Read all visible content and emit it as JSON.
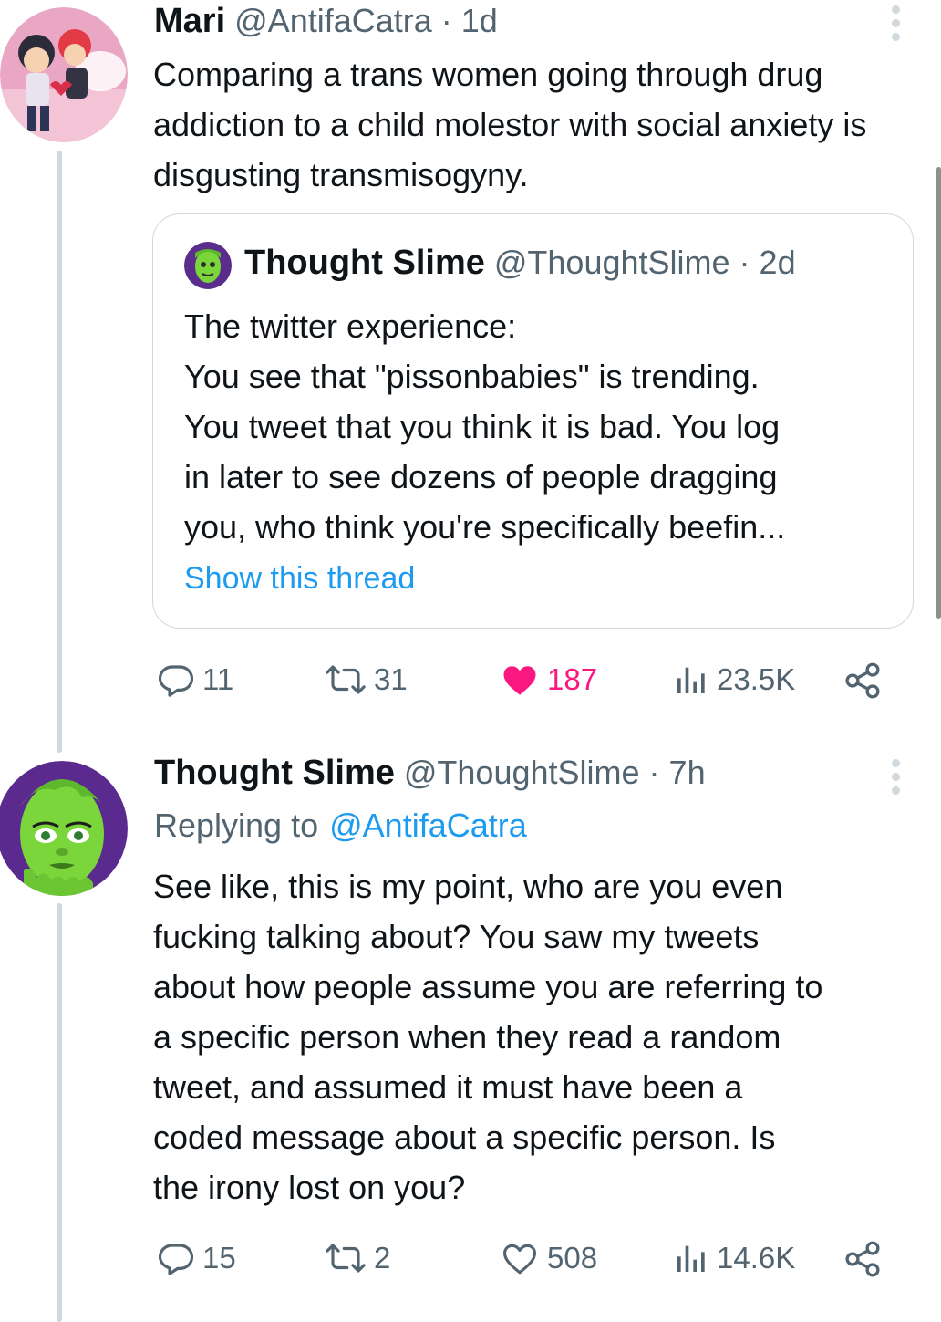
{
  "tweet1": {
    "name": "Mari",
    "handle": "@AntifaCatra",
    "time": "1d",
    "text": "Comparing a trans women going through drug addiction to a child molestor with social anxiety is disgusting transmisogyny.",
    "quote": {
      "name": "Thought Slime",
      "handle": "@ThoughtSlime",
      "time": "2d",
      "lines": [
        "The twitter experience:",
        "You see that \"pissonbabies\" is trending.",
        "You tweet that you think it is bad. You log",
        "in later to see dozens of people dragging",
        "you, who think you're specifically beefin..."
      ],
      "show_thread": "Show this thread"
    },
    "actions": {
      "replies": "11",
      "retweets": "31",
      "likes": "187",
      "views": "23.5K"
    }
  },
  "tweet2": {
    "name": "Thought Slime",
    "handle": "@ThoughtSlime",
    "time": "7h",
    "replying_prefix": "Replying to",
    "replying_to": "@AntifaCatra",
    "lines": [
      "See like, this is my point, who are you even",
      "fucking talking about? You saw my tweets",
      "about how people assume you are referring to",
      "a specific person when they read a random",
      "tweet, and assumed it must have been a",
      "coded message about a specific person. Is",
      "the irony lost on you?"
    ],
    "actions": {
      "replies": "15",
      "retweets": "2",
      "likes": "508",
      "views": "14.6K"
    }
  },
  "colors": {
    "text": "#0f1419",
    "secondary": "#536471",
    "link": "#1d9bf0",
    "like": "#f91880",
    "line": "#cfd9de"
  },
  "separator": "·"
}
